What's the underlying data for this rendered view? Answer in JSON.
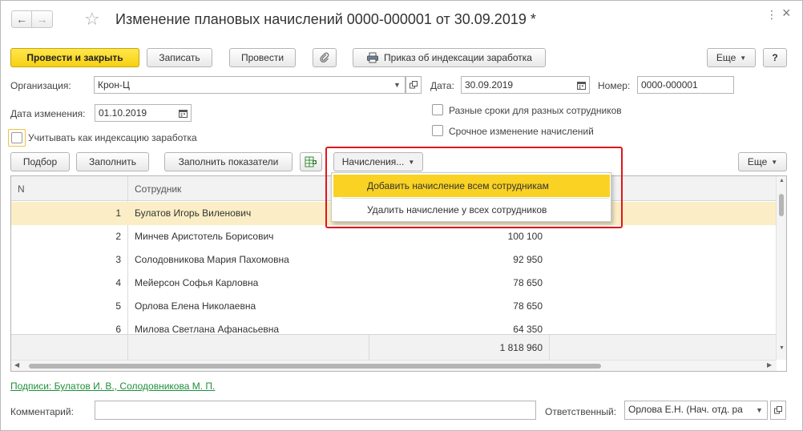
{
  "window": {
    "title": "Изменение плановых начислений 0000-000001 от 30.09.2019 *",
    "back_icon": "←",
    "forward_icon": "→",
    "star_icon": "☆",
    "more_icon": "⋮",
    "close_icon": "×"
  },
  "toolbar": {
    "post_close": "Провести и закрыть",
    "save": "Записать",
    "post": "Провести",
    "order": "Приказ об индексации заработка",
    "more": "Еще",
    "help": "?"
  },
  "form": {
    "org_label": "Организация:",
    "org_value": "Крон-Ц",
    "date_label": "Дата:",
    "date_value": "30.09.2019",
    "number_label": "Номер:",
    "number_value": "0000-000001",
    "change_date_label": "Дата изменения:",
    "change_date_value": "01.10.2019",
    "diff_terms": "Разные сроки для разных сотрудников",
    "urgent_change": "Срочное изменение начислений",
    "index_check": "Учитывать как индексацию заработка"
  },
  "tab_toolbar": {
    "pick": "Подбор",
    "fill": "Заполнить",
    "fill_indicators": "Заполнить показатели",
    "accruals": "Начисления...",
    "more": "Еще"
  },
  "table": {
    "col_n": "N",
    "col_employee": "Сотрудник",
    "rows": [
      {
        "n": "1",
        "name": "Булатов Игорь Виленович",
        "sum": ""
      },
      {
        "n": "2",
        "name": "Минчев Аристотель Борисович",
        "sum": "100 100"
      },
      {
        "n": "3",
        "name": "Солодовникова Мария Пахомовна",
        "sum": "92 950"
      },
      {
        "n": "4",
        "name": "Мейерсон Софья Карловна",
        "sum": "78 650"
      },
      {
        "n": "5",
        "name": "Орлова Елена Николаевна",
        "sum": "78 650"
      },
      {
        "n": "6",
        "name": "Милова Светлана Афанасьевна",
        "sum": "64 350"
      }
    ],
    "total": "1 818 960"
  },
  "menu": {
    "add_all": "Добавить начисление всем сотрудникам",
    "remove_all": "Удалить начисление у всех сотрудников"
  },
  "footer": {
    "signatures": "Подписи: Булатов И. В., Солодовникова М. П.",
    "comment_label": "Комментарий:",
    "comment_value": "",
    "responsible_label": "Ответственный:",
    "responsible_value": "Орлова Е.Н. (Нач. отд. ра"
  },
  "colors": {
    "accent": "#f7d011",
    "selected_row": "#fbeec6",
    "highlight": "#e0161a",
    "link": "#1f8f3a"
  }
}
